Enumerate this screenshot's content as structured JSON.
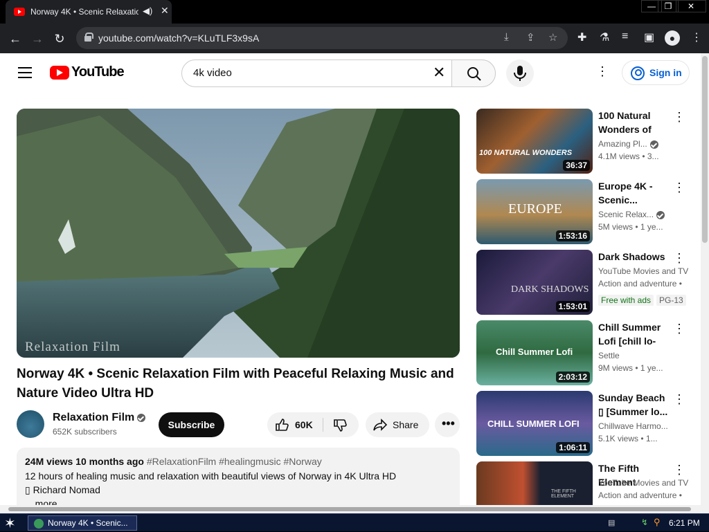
{
  "browser": {
    "tab_title": "Norway 4K • Scenic Relaxation",
    "url": "youtube.com/watch?v=KLuTLF3x9sA",
    "win_min": "—",
    "win_restore": "❐",
    "win_close": "✕"
  },
  "masthead": {
    "logo_text": "YouTube",
    "search_query": "4k video",
    "signin_label": "Sign in"
  },
  "video": {
    "watermark": "Relaxation Film",
    "title": "Norway 4K • Scenic Relaxation Film with Peaceful Relaxing Music and Nature Video Ultra HD",
    "channel_name": "Relaxation Film",
    "subscribers": "652K subscribers",
    "subscribe_label": "Subscribe",
    "likes": "60K",
    "share_label": "Share",
    "views_date": "24M views  10 months ago",
    "hashtags": "#RelaxationFilm #healingmusic #Norway",
    "desc_line1": "12 hours of healing music and relaxation with beautiful views of Norway in 4K Ultra HD",
    "desc_line2": "▯ Richard Nomad",
    "more_label": "...more"
  },
  "recommendations": [
    {
      "title": "100 Natural Wonders of th...",
      "channel": "Amazing Pl...",
      "verified": true,
      "views": "4.1M views  • 3...",
      "duration": "36:37",
      "overlay": "100 NATURAL WONDERS"
    },
    {
      "title": "Europe 4K - Scenic...",
      "channel": "Scenic Relax...",
      "verified": true,
      "views": "5M views  • 1 ye...",
      "duration": "1:53:16",
      "overlay": "EUROPE"
    },
    {
      "title": "Dark Shadows",
      "channel": "YouTube Movies and TV",
      "line2": "Action and adventure •",
      "badge1": "Free with ads",
      "badge2": "PG-13",
      "duration": "1:53:01",
      "overlay": "DARK SHADOWS"
    },
    {
      "title": "Chill Summer Lofi [chill lo-fi...",
      "channel": "Settle",
      "views": "9M views  • 1 ye...",
      "duration": "2:03:12",
      "overlay": "Chill Summer Lofi"
    },
    {
      "title": "Sunday Beach ▯ [Summer lo...",
      "channel": "Chillwave Harmo...",
      "views": "5.1K views  • 1...",
      "duration": "1:06:11",
      "overlay": "CHILL SUMMER LOFI"
    },
    {
      "title": "The Fifth Element",
      "channel": "YouTube Movies and TV",
      "line2": "Action and adventure •",
      "duration": "",
      "overlay": "THE FIFTH ELEMENT"
    }
  ],
  "taskbar": {
    "task_label": "Norway 4K • Scenic...",
    "clock": "6:21 PM"
  }
}
